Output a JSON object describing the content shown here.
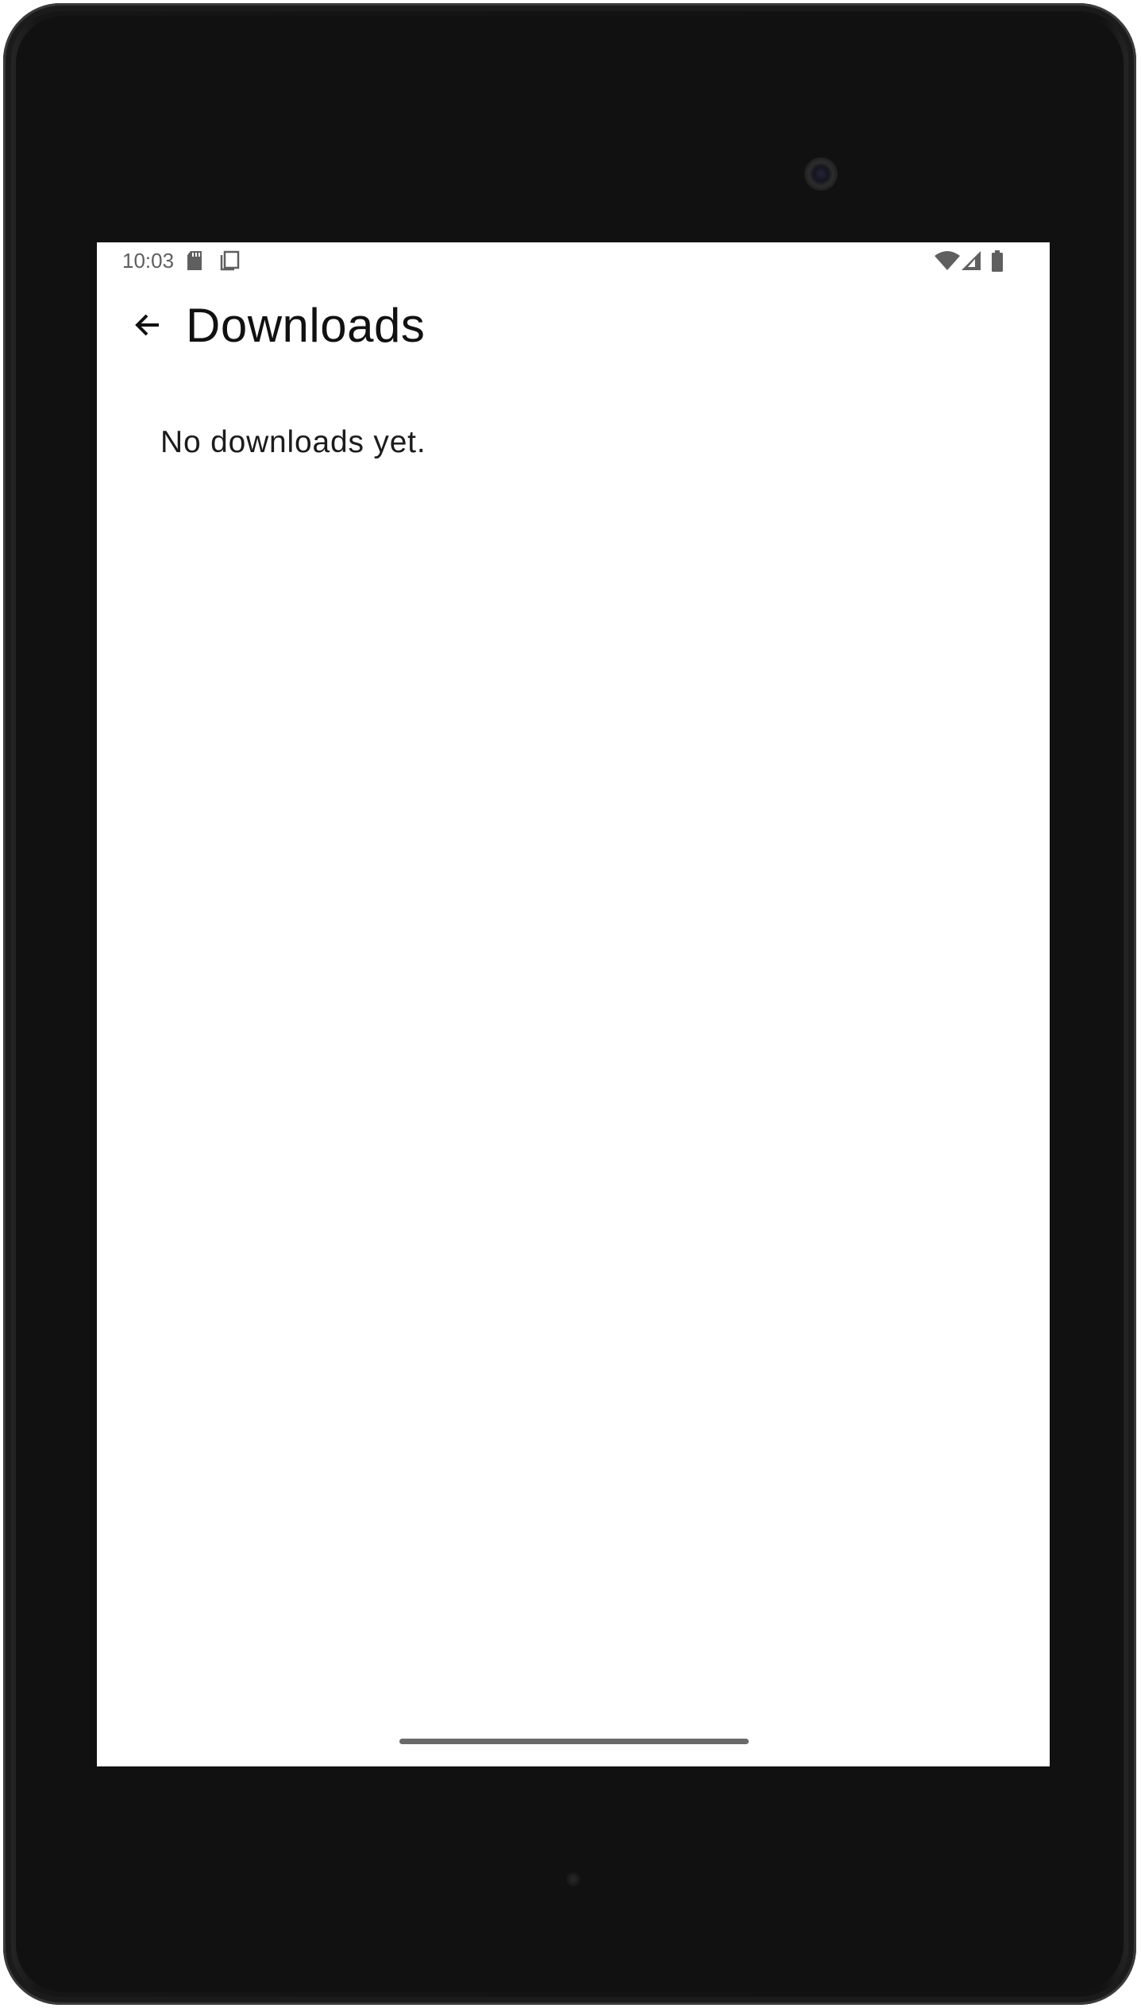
{
  "status_bar": {
    "time": "10:03",
    "left_icons": [
      "sd-card-icon",
      "screenshot-icon"
    ],
    "right_icons": [
      "wifi-icon",
      "cell-signal-icon",
      "battery-icon"
    ]
  },
  "app_bar": {
    "back_icon": "arrow-back-icon",
    "title": "Downloads"
  },
  "content": {
    "empty_message": "No downloads yet."
  },
  "colors": {
    "screen_bg": "#ffffff",
    "device_frame": "#131313",
    "status_icon": "#5f5f5f",
    "text_primary": "#111111"
  }
}
